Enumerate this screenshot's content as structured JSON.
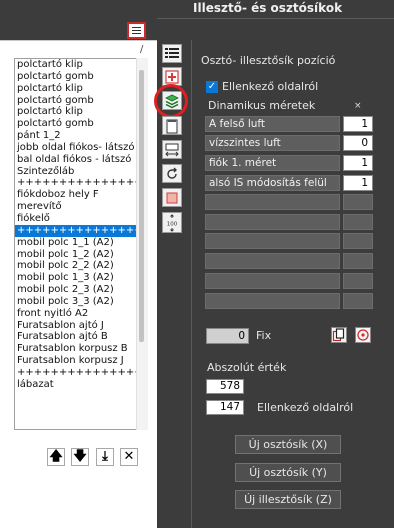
{
  "window": {
    "title": "Illesztő- és osztósíkok"
  },
  "list": {
    "slash": "/",
    "items": [
      "polctartó klip",
      "polctartó gomb",
      "polctartó klip",
      "polctartó gomb",
      "polctartó klip",
      "polctartó gomb",
      "pánt 1_2",
      "jobb oldal fiókos- látszó",
      "bal oldal fiókos - látszó",
      "Szintezőláb",
      "++++++++++++++++ Z",
      "fiókdoboz hely F",
      "merevítő",
      "fiókelő",
      "++++++++++++++++ Z",
      "mobil polc 1_1 (A2)",
      "mobil polc 1_2 (A2)",
      "mobil polc 2_2 (A2)",
      "mobil polc 1_3 (A2)",
      "mobil polc 2_3 (A2)",
      "mobil polc 3_3 (A2)",
      "front nyitló A2",
      "Furatsablon ajtó J",
      "Furatsablon ajtó B",
      "Furatsablon korpusz B",
      "Furatsablon korpusz J",
      "++++++++++++++++ Z",
      "lábazat"
    ],
    "selected_index": 14
  },
  "list_buttons": {
    "up": "🡅",
    "down": "🡇",
    "bottom": "⤓",
    "delete": "✕"
  },
  "tools": [
    "list-icon",
    "plus-square-icon",
    "layers-icon",
    "page-icon",
    "resize-h-icon",
    "rotate-icon",
    "square-icon",
    "scale-100-icon"
  ],
  "tool_scale_label": "100",
  "panel": {
    "title": "Osztó- illesztősík pozíció",
    "checkbox_label": "Ellenkező oldalról",
    "checkbox_checked": true,
    "dyn_label": "Dinamikus méretek",
    "x_label": "×",
    "rows": [
      {
        "label": "A felső luft",
        "value": "1"
      },
      {
        "label": "vízszintes luft",
        "value": "0"
      },
      {
        "label": "fiók 1. méret",
        "value": "1"
      },
      {
        "label": "alsó IS módosítás felül",
        "value": "1"
      },
      {
        "label": "",
        "value": ""
      },
      {
        "label": "",
        "value": ""
      },
      {
        "label": "",
        "value": ""
      },
      {
        "label": "",
        "value": ""
      },
      {
        "label": "",
        "value": ""
      },
      {
        "label": "",
        "value": ""
      }
    ],
    "fix_value": "0",
    "fix_label": "Fix",
    "abs_label": "Abszolút érték",
    "abs_value1": "578",
    "abs_value2": "147",
    "abs_value2_label": "Ellenkező oldalról",
    "btn_split_x": "Új osztósík (X)",
    "btn_split_y": "Új osztósík (Y)",
    "btn_fit_z": "Új illesztősík (Z)"
  },
  "colors": {
    "accent": "#0a78d7",
    "highlight": "#e02020",
    "background": "#3c3c3c"
  }
}
